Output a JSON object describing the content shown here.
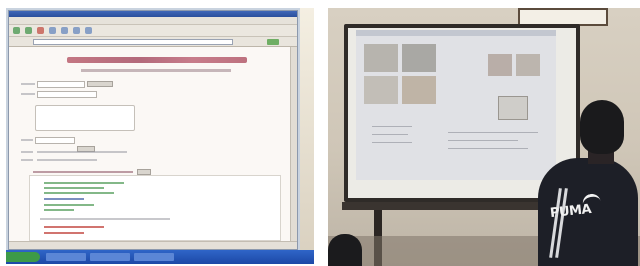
{
  "left_panel": {
    "screenshot_text": "",
    "browser_controls": [
      "back",
      "forward",
      "stop",
      "refresh",
      "home",
      "search",
      "favorites"
    ]
  },
  "right_panel": {
    "shirt_logo_text": "PUMA",
    "colors": {
      "board_frame": "#2f2b28",
      "screen": "#e0e1e5",
      "shirt": "#1d1f27"
    }
  }
}
